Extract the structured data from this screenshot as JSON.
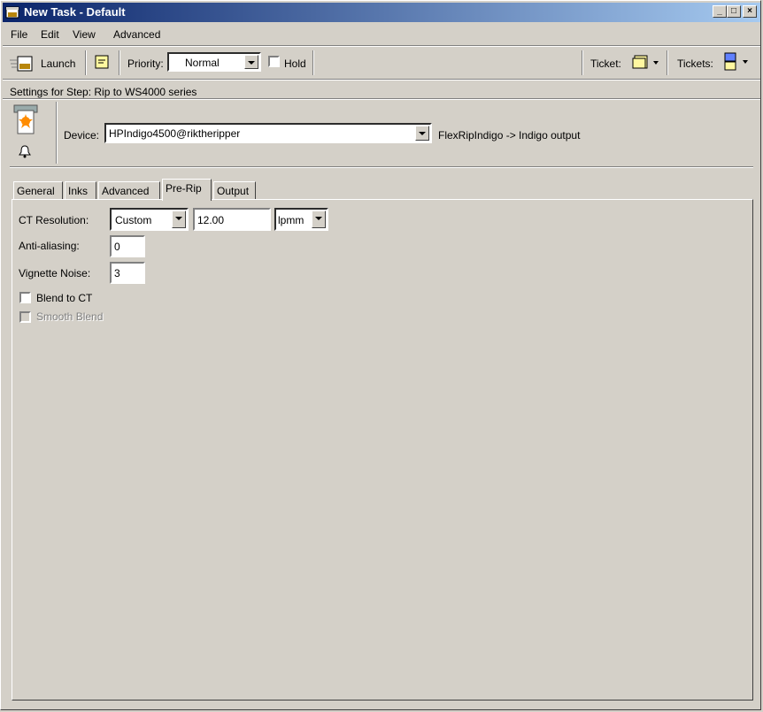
{
  "window": {
    "title": "New Task - Default"
  },
  "menu": {
    "file": "File",
    "edit": "Edit",
    "view": "View",
    "advanced": "Advanced"
  },
  "toolbar": {
    "launch": "Launch",
    "priority_label": "Priority:",
    "priority_value": "Normal",
    "hold": "Hold",
    "ticket": "Ticket:",
    "tickets": "Tickets:"
  },
  "settings": {
    "step_label": "Settings for Step: Rip to WS4000 series",
    "device_label": "Device:",
    "device_value": "HPIndigo4500@riktheripper",
    "device_output": "FlexRipIndigo -> Indigo output"
  },
  "tabs": [
    "General",
    "Inks",
    "Advanced",
    "Pre-Rip",
    "Output"
  ],
  "prerip": {
    "ct_label": "CT Resolution:",
    "ct_mode": "Custom",
    "ct_value": "12.00",
    "ct_unit": "lpmm",
    "aa_label": "Anti-aliasing:",
    "aa_value": "0",
    "vn_label": "Vignette Noise:",
    "vn_value": "3",
    "blend_label": "Blend to CT",
    "smooth_label": "Smooth Blend"
  }
}
